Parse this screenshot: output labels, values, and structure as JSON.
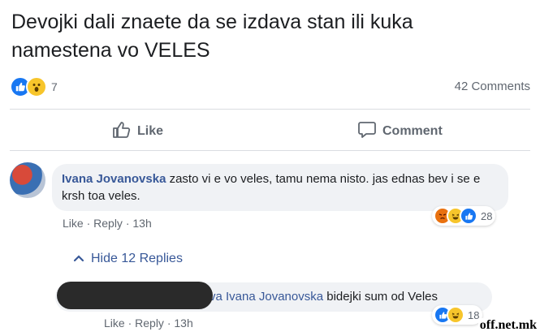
{
  "post": {
    "text_line1": "Devojki dali znaete da se izdava stan ili kuka",
    "text_line2": "namestena vo VELES",
    "reaction_count": "7",
    "comments_count": "42 Comments",
    "like_label": "Like",
    "comment_label": "Comment"
  },
  "comment1": {
    "author": "Ivana Jovanovska",
    "text": " zasto vi e vo veles, tamu nema nisto. jas ednas bev i se e krsh toa veles.",
    "like": "Like",
    "reply": "Reply",
    "time": "13h",
    "reaction_count": "28",
    "hide_replies": "Hide 12 Replies"
  },
  "reply1": {
    "mention_fragment": "va",
    "mentioned": "Ivana Jovanovska",
    "text": " bidejki sum od Veles",
    "like": "Like",
    "reply": "Reply",
    "time": "13h",
    "reaction_count": "18"
  },
  "watermark": "off.net.mk",
  "icons": [
    "like-icon",
    "wow-icon",
    "angry-icon",
    "haha-icon",
    "thumb-up-icon",
    "comment-bubble-icon",
    "chevron-up-icon"
  ],
  "colors": {
    "link": "#385898",
    "muted": "#606770",
    "like_blue": "#1877f2",
    "bubble_bg": "#f0f2f5"
  }
}
